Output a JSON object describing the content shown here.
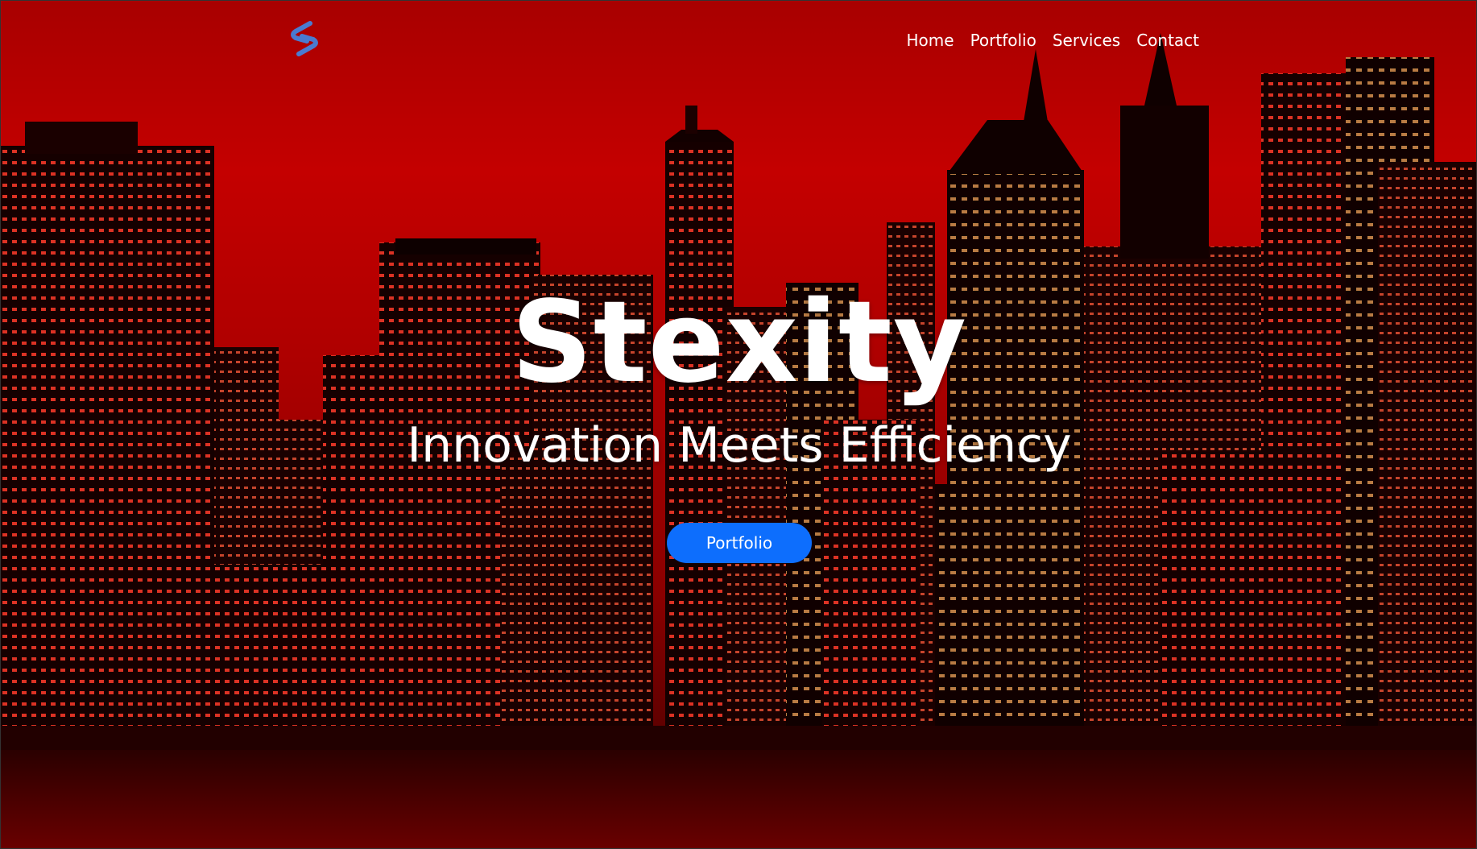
{
  "header": {
    "logo_icon": "stexity-logo-icon",
    "nav": [
      {
        "label": "Home"
      },
      {
        "label": "Portfolio"
      },
      {
        "label": "Services"
      },
      {
        "label": "Contact"
      }
    ]
  },
  "hero": {
    "title": "Stexity",
    "subtitle": "Innovation Meets Efficiency",
    "cta_label": "Portfolio",
    "background": "red-tinted-city-skyline-at-night"
  },
  "colors": {
    "accent": "#0d6efd",
    "background_tint": "#c40000",
    "text": "#ffffff"
  }
}
